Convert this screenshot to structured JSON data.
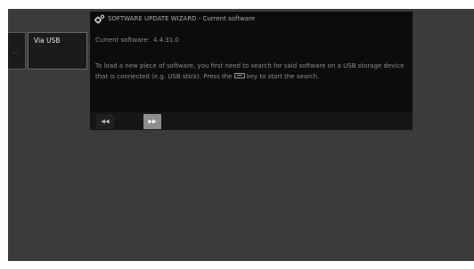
{
  "side_menu": {
    "prev_item_fragment": "...",
    "selected_item_label": "Via USB"
  },
  "dialog": {
    "title": "SOFTWARE UPDATE WIZARD - Current software",
    "title_icon": "gear-icon",
    "current_software_label": "Current software:",
    "current_software_version": "4.4.31.0",
    "body_text_before_key": "To load a new piece of software, you first need to search for said software on a USB storage device that is connected (e.g. USB stick). Press the",
    "body_key_icon": "keyboard-key-icon",
    "body_text_after_key": "key to start the search."
  },
  "navigation": {
    "back_label": "◀◀",
    "forward_label": "▶▶",
    "forward_active": true
  },
  "colors": {
    "background": "#3d3b3a",
    "dialog_background": "#0c0c0c",
    "text": "#8d8d8d",
    "active_button": "#8e8e8e"
  }
}
